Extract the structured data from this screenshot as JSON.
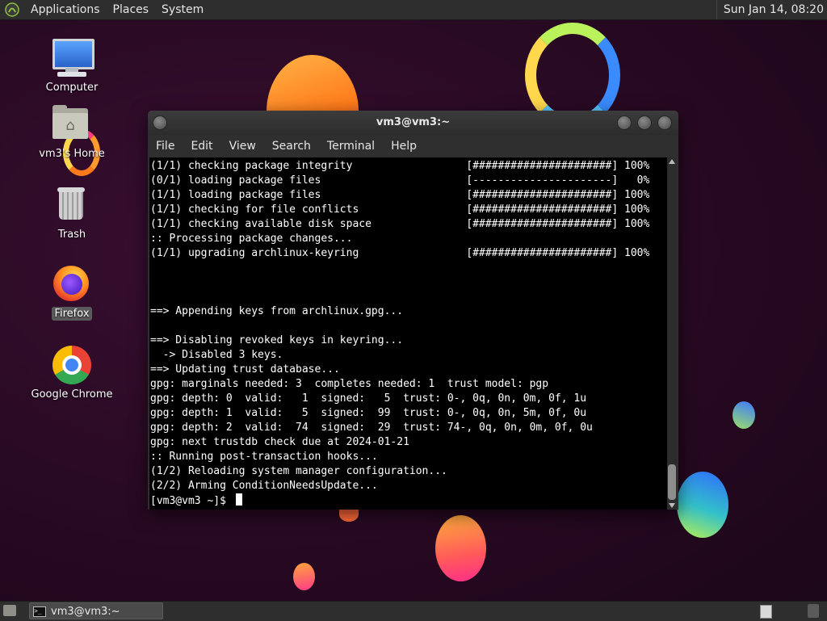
{
  "top_panel": {
    "menus": [
      "Applications",
      "Places",
      "System"
    ],
    "clock": "Sun Jan 14, 08:20"
  },
  "desktop_icons": [
    {
      "label": "Computer",
      "icon": "computer-icon"
    },
    {
      "label": "vm3's Home",
      "icon": "home-folder-icon"
    },
    {
      "label": "Trash",
      "icon": "trash-icon"
    },
    {
      "label": "Firefox",
      "icon": "firefox-icon",
      "selected": true
    },
    {
      "label": "Google Chrome",
      "icon": "chrome-icon"
    }
  ],
  "window": {
    "title": "vm3@vm3:~",
    "menu": [
      "File",
      "Edit",
      "View",
      "Search",
      "Terminal",
      "Help"
    ]
  },
  "terminal": {
    "lines": [
      "(1/1) checking package integrity                  [######################] 100%",
      "(0/1) loading package files                       [----------------------]   0%",
      "(1/1) loading package files                       [######################] 100%",
      "(1/1) checking for file conflicts                 [######################] 100%",
      "(1/1) checking available disk space               [######################] 100%",
      ":: Processing package changes...",
      "(1/1) upgrading archlinux-keyring                 [######################] 100%",
      "",
      "",
      "",
      "==> Appending keys from archlinux.gpg...",
      "",
      "==> Disabling revoked keys in keyring...",
      "  -> Disabled 3 keys.",
      "==> Updating trust database...",
      "gpg: marginals needed: 3  completes needed: 1  trust model: pgp",
      "gpg: depth: 0  valid:   1  signed:   5  trust: 0-, 0q, 0n, 0m, 0f, 1u",
      "gpg: depth: 1  valid:   5  signed:  99  trust: 0-, 0q, 0n, 5m, 0f, 0u",
      "gpg: depth: 2  valid:  74  signed:  29  trust: 74-, 0q, 0n, 0m, 0f, 0u",
      "gpg: next trustdb check due at 2024-01-21",
      ":: Running post-transaction hooks...",
      "(1/2) Reloading system manager configuration...",
      "(2/2) Arming ConditionNeedsUpdate..."
    ],
    "prompt": "[vm3@vm3 ~]$ "
  },
  "bottom_panel": {
    "task_label": "vm3@vm3:~",
    "task_icon": ">_"
  }
}
